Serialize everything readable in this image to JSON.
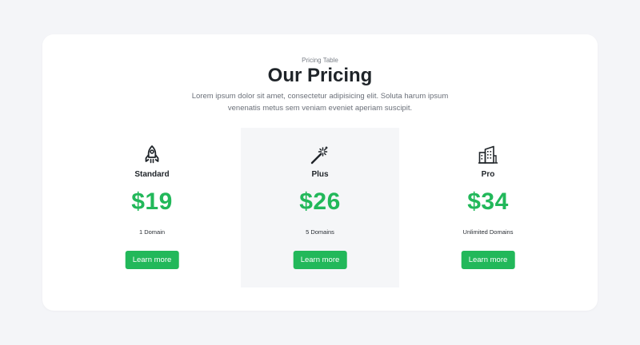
{
  "header": {
    "eyebrow": "Pricing Table",
    "title": "Our Pricing",
    "description": "Lorem ipsum dolor sit amet, consectetur adipisicing elit. Soluta harum ipsum venenatis metus sem veniam eveniet aperiam suscipit."
  },
  "colors": {
    "accent": "#22b85a",
    "featured_background": "#f5f6f8",
    "page_background": "#f4f5f8"
  },
  "plans": [
    {
      "icon": "rocket-icon",
      "name": "Standard",
      "price": "$19",
      "feature": "1 Domain",
      "button_label": "Learn more",
      "featured": false
    },
    {
      "icon": "magic-wand-icon",
      "name": "Plus",
      "price": "$26",
      "feature": "5 Domains",
      "button_label": "Learn more",
      "featured": true
    },
    {
      "icon": "buildings-icon",
      "name": "Pro",
      "price": "$34",
      "feature": "Unlimited Domains",
      "button_label": "Learn more",
      "featured": false
    }
  ]
}
